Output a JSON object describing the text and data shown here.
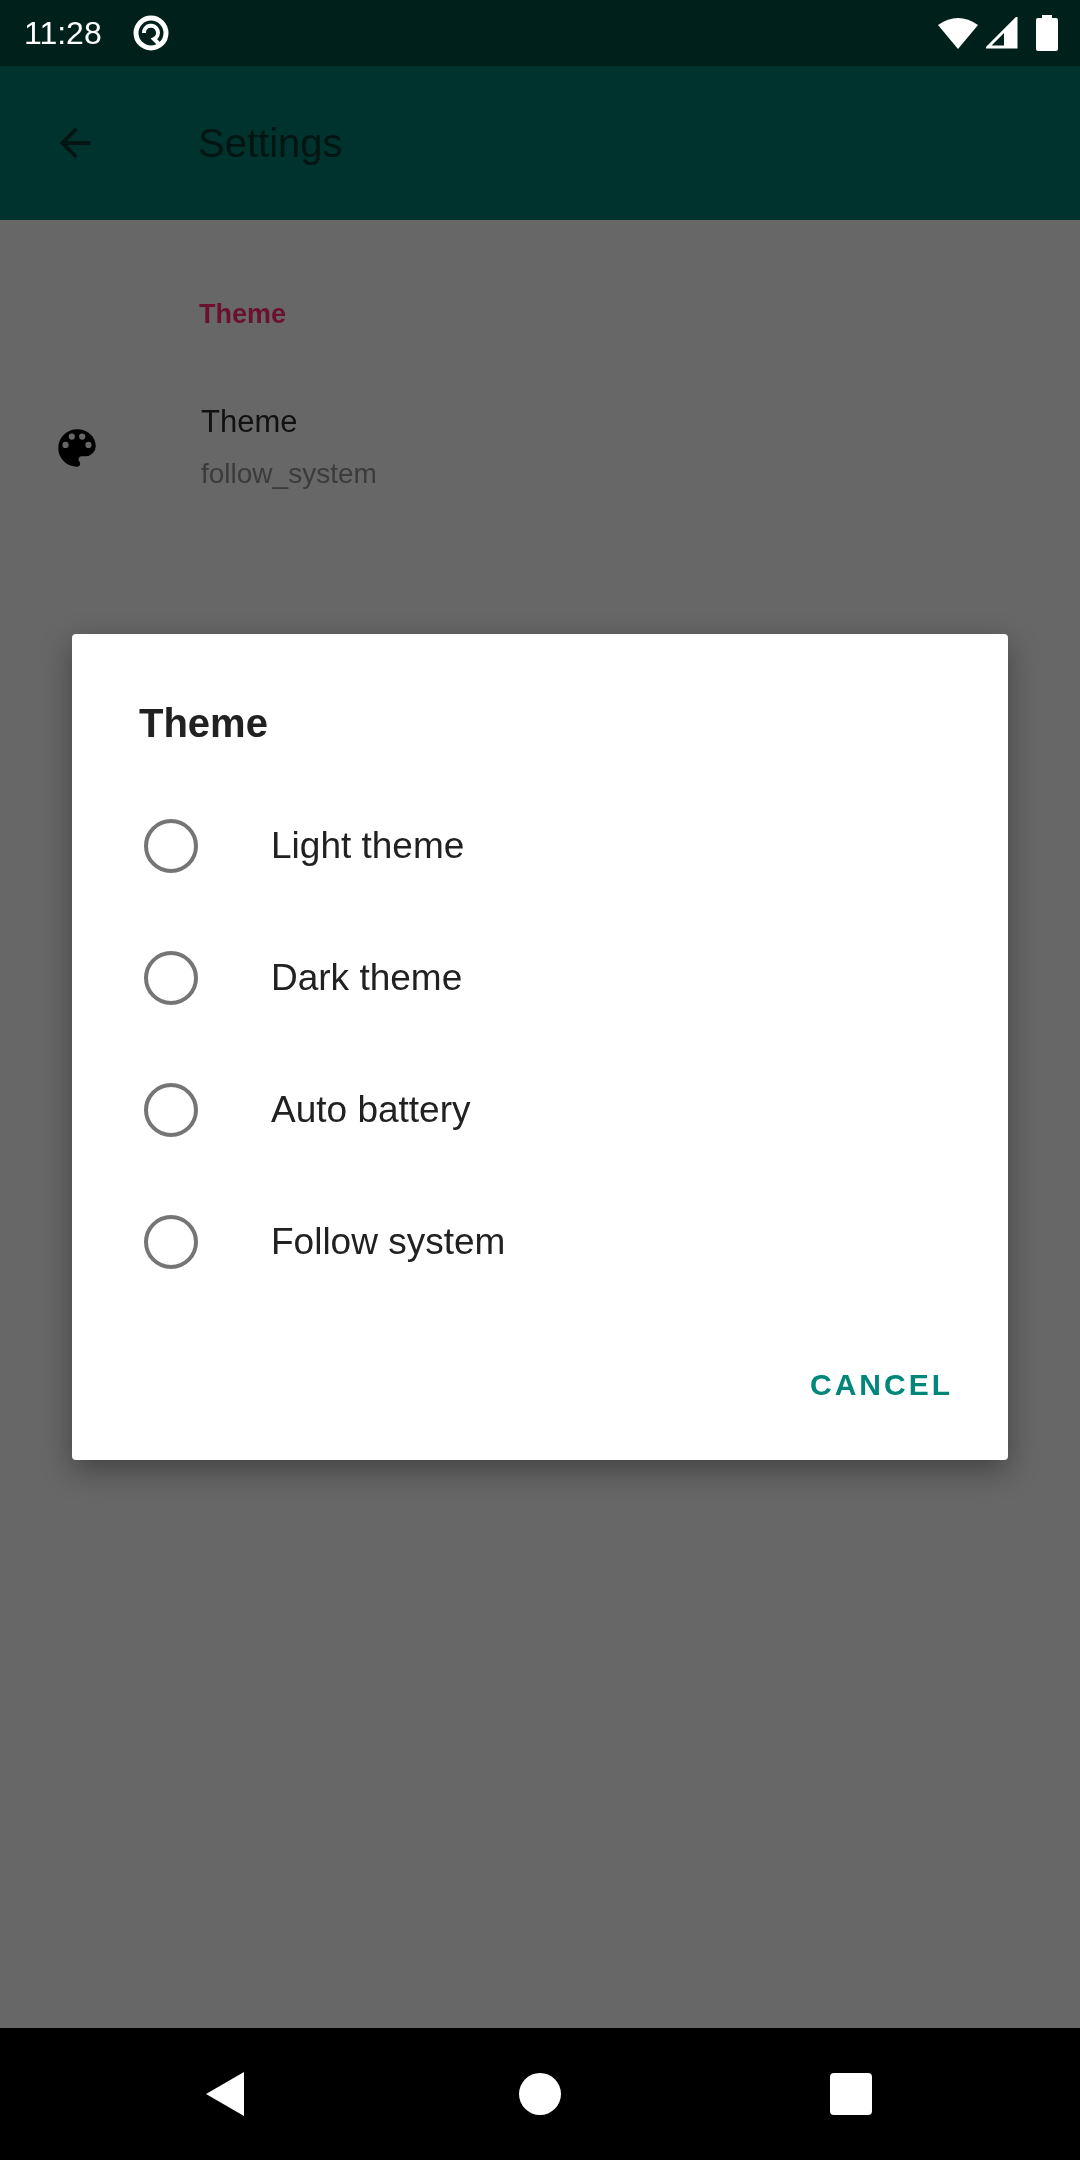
{
  "status_bar": {
    "time": "11:28"
  },
  "app_bar": {
    "title": "Settings"
  },
  "category": {
    "title": "Theme"
  },
  "preference": {
    "title": "Theme",
    "summary": "follow_system"
  },
  "dialog": {
    "title": "Theme",
    "options": [
      {
        "label": "Light theme",
        "selected": false
      },
      {
        "label": "Dark theme",
        "selected": false
      },
      {
        "label": "Auto battery",
        "selected": false
      },
      {
        "label": "Follow system",
        "selected": false
      }
    ],
    "buttons": [
      {
        "label": "CANCEL"
      }
    ]
  }
}
